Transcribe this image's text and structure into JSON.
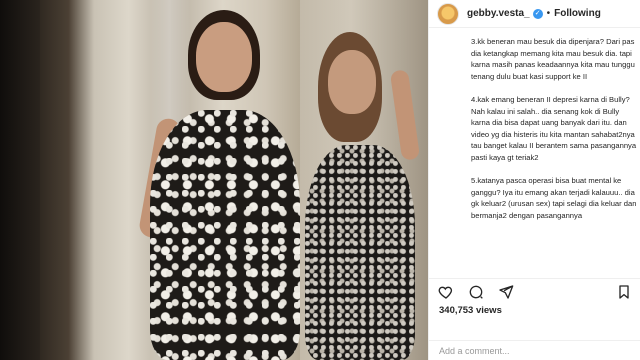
{
  "post": {
    "username": "gebby.vesta_",
    "verified_mark": "✓",
    "separator": "•",
    "follow_label": "Following"
  },
  "caption": {
    "paragraphs": [
      "3.kk beneran mau besuk dia dipenjara? Dari pas dia ketangkap memang kita mau besuk dia. tapi karna masih panas keadaannya kita mau tunggu tenang dulu buat kasi support ke II",
      "4.kak emang beneran II depresi karna di Bully? Nah kalau ini salah.. dia senang kok di Bully karna dia bisa dapat uang banyak dari itu. dan video yg dia histeris itu kita mantan sahabat2nya tau banget kalau II berantem sama pasangannya pasti kaya gt teriak2",
      "5.katanya pasca operasi bisa buat mental ke ganggu? Iya itu emang akan terjadi kalauuu.. dia gk keluar2 (urusan sex) tapi selagi dia keluar dan bermanja2 dengan pasangannya"
    ]
  },
  "actions": {
    "like_icon": "heart-icon",
    "comment_icon": "comment-icon",
    "share_icon": "share-icon",
    "save_icon": "bookmark-icon"
  },
  "likes": {
    "count": "340,753 views"
  },
  "comment": {
    "placeholder": "Add a comment..."
  }
}
